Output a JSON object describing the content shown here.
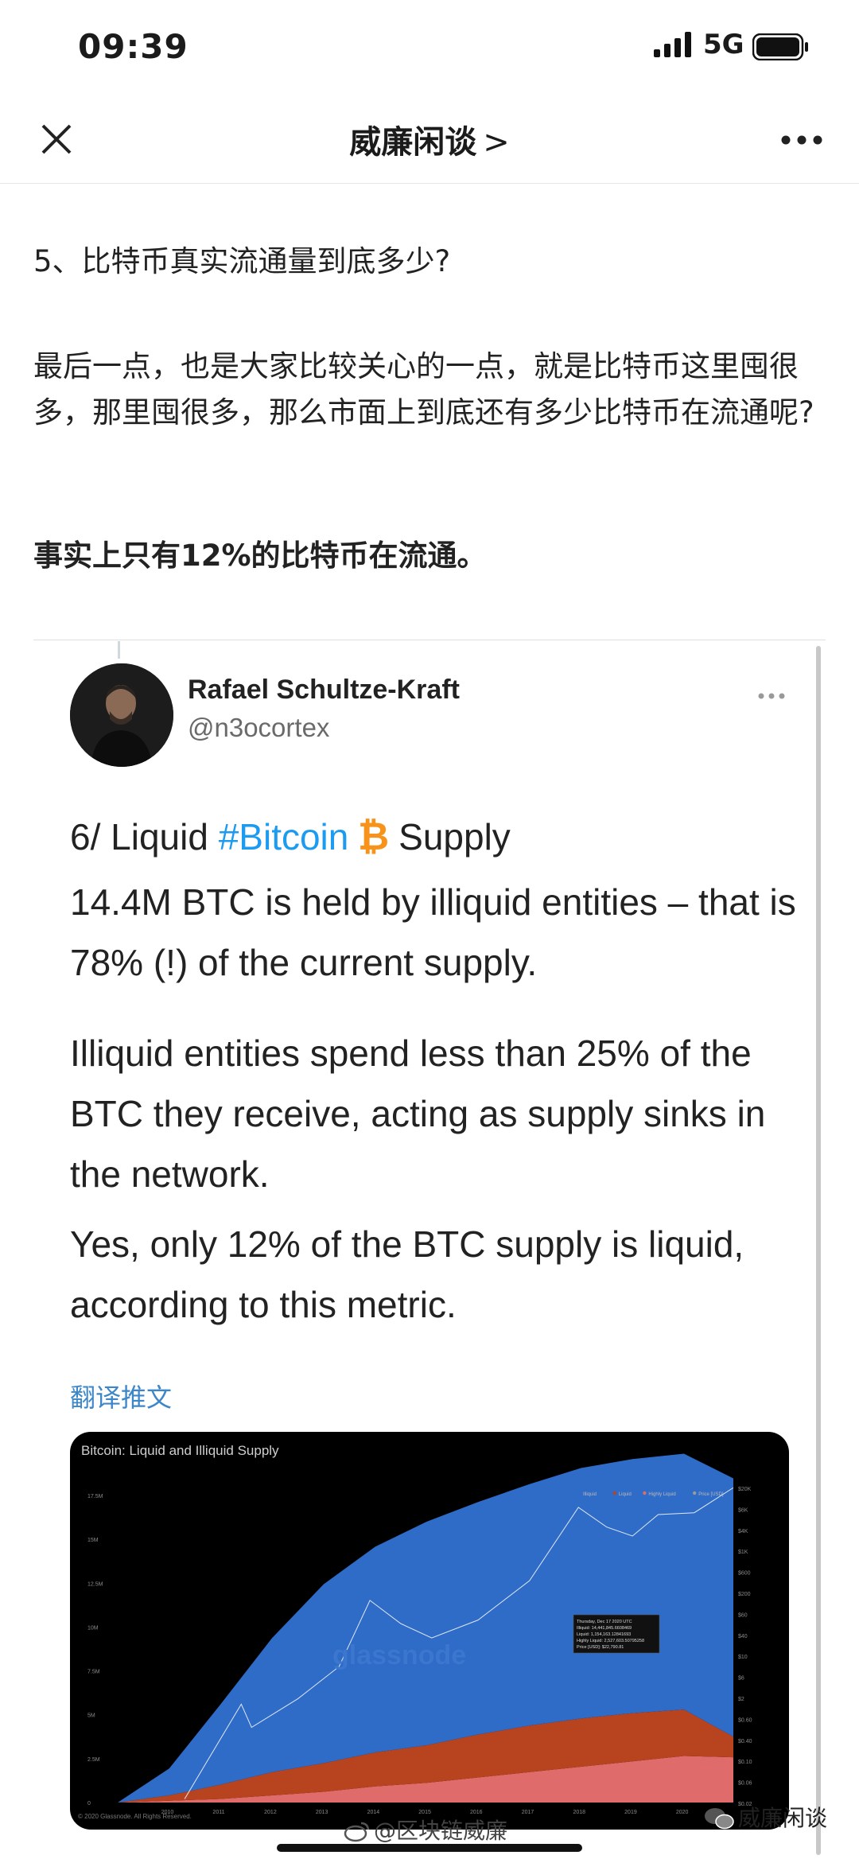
{
  "status_bar": {
    "time": "09:39",
    "network": "5G"
  },
  "nav": {
    "title": "威廉闲谈",
    "chevron": ">"
  },
  "article": {
    "heading": "5、比特币真实流通量到底多少?",
    "body": "最后一点，也是大家比较关心的一点，就是比特币这里囤很多，那里囤很多，那么市面上到底还有多少比特币在流通呢?",
    "bold": "事实上只有12%的比特币在流通。"
  },
  "tweet": {
    "name": "Rafael Schultze-Kraft",
    "handle": "@n3ocortex",
    "line1_pre": "6/ Liquid ",
    "line1_tag": "#Bitcoin",
    "line1_emoji": "₿",
    "line1_post": " Supply",
    "para1": "14.4M BTC is held by illiquid entities – that is 78% (!) of the current supply.",
    "para2": "Illiquid entities spend less than 25% of the BTC they receive, acting as supply sinks in the network.",
    "para3": "Yes, only 12% of the BTC supply is liquid, according to this metric.",
    "translate": "翻译推文"
  },
  "chart_data": {
    "type": "area",
    "title": "Bitcoin: Liquid and Illiquid Supply",
    "legend": [
      "Illiquid",
      "Liquid",
      "Highly Liquid",
      "Price [USD]"
    ],
    "legend_position": "top-right",
    "x_ticks": [
      "2010",
      "2011",
      "2012",
      "2013",
      "2014",
      "2015",
      "2016",
      "2017",
      "2018",
      "2019",
      "2020"
    ],
    "y_ticks_left": [
      "0",
      "2.5M",
      "5M",
      "7.5M",
      "10M",
      "12.5M",
      "15M",
      "17.5M"
    ],
    "y_ticks_right": [
      "$0.02",
      "$0.06",
      "$0.10",
      "$0.40",
      "$0.60",
      "$2",
      "$6",
      "$10",
      "$40",
      "$60",
      "$200",
      "$600",
      "$1K",
      "$4K",
      "$6K",
      "$20K"
    ],
    "x": [
      2009.0,
      2010.0,
      2011.0,
      2012.0,
      2013.0,
      2014.0,
      2015.0,
      2016.0,
      2017.0,
      2018.0,
      2019.0,
      2020.0,
      2020.96
    ],
    "series": [
      {
        "name": "Illiquid",
        "color": "#2f6cc7",
        "values": [
          0,
          1.5,
          4.5,
          7.5,
          10.0,
          11.5,
          12.5,
          13.0,
          13.5,
          14.0,
          14.2,
          14.3,
          14.44
        ]
      },
      {
        "name": "Liquid",
        "color": "#b8441f",
        "values": [
          0,
          0.3,
          0.8,
          1.3,
          1.6,
          1.9,
          2.1,
          2.4,
          2.6,
          2.7,
          2.7,
          2.6,
          1.15
        ]
      },
      {
        "name": "Highly Liquid",
        "color": "#e06b6b",
        "values": [
          0,
          0.1,
          0.2,
          0.4,
          0.6,
          0.9,
          1.1,
          1.4,
          1.7,
          2.0,
          2.3,
          2.6,
          2.53
        ]
      }
    ],
    "ylim": [
      0,
      18.5
    ],
    "tooltip": [
      "Thursday, Dec 17 2020 UTC",
      "Illiquid: 14,441,845.6608469",
      "Liquid: 1,154,163.12841693",
      "Highly Liquid: 2,527,603.50795258",
      "Price [USD]: $22,790.81"
    ],
    "watermark": "glassnode",
    "copyright": "© 2020 Glassnode. All Rights Reserved."
  },
  "watermark": {
    "left": "@区块链威廉",
    "right": "威廉闲谈"
  }
}
